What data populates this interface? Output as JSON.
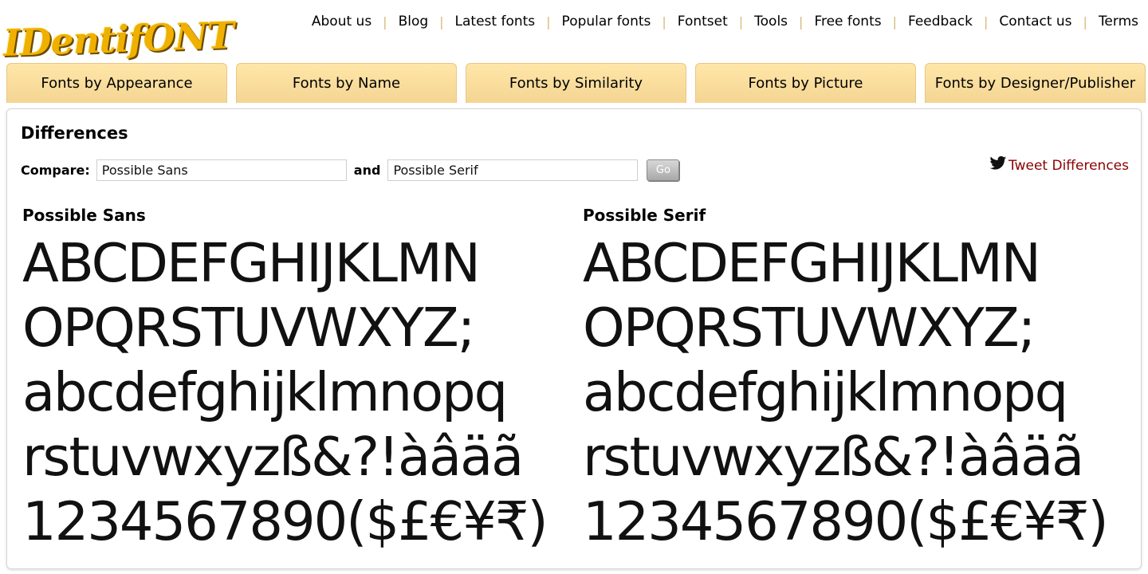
{
  "header": {
    "logo_text": "IDentifONT",
    "nav": [
      "About us",
      "Blog",
      "Latest fonts",
      "Popular fonts",
      "Fontset",
      "Tools",
      "Free fonts",
      "Feedback",
      "Contact us",
      "Terms"
    ]
  },
  "tabs": [
    "Fonts by Appearance",
    "Fonts by Name",
    "Fonts by Similarity",
    "Fonts by Picture",
    "Fonts by Designer/Publisher"
  ],
  "main": {
    "title": "Differences",
    "compare_label": "Compare:",
    "field1_value": "Possible Sans",
    "and_label": "and",
    "field2_value": "Possible Serif",
    "go_label": "Go",
    "tweet_label": "Tweet Differences"
  },
  "samples": {
    "left_name": "Possible Sans",
    "right_name": "Possible Serif",
    "lines": [
      "ABCDEFGHIJKLMN",
      "OPQRSTUVWXYZ;",
      "abcdefghijklmnopq",
      "rstuvwxyzß&?!àâäã",
      "1234567890($£€¥₹)"
    ]
  },
  "colors": {
    "tab_bg": "#ffe6a8",
    "tweet_link": "#8b0000",
    "logo": "#f0b000"
  }
}
